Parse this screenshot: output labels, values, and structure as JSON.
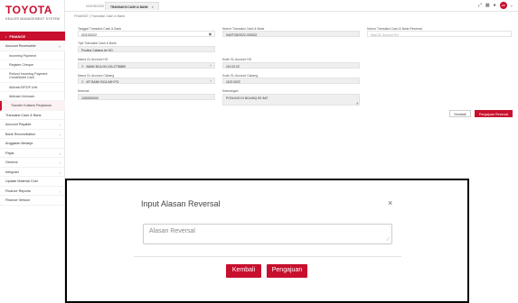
{
  "brand": {
    "name": "TOYOTA",
    "tagline": "DEALER MANAGEMENT SYSTEM",
    "color": "#c8102e"
  },
  "sidebar": {
    "section": "FINANCE",
    "items": [
      {
        "label": "Account Receivable",
        "expanded": true
      },
      {
        "label": "Transaksi Cash & Bank"
      },
      {
        "label": "Account Payable"
      },
      {
        "label": "Bank Reconciliation"
      },
      {
        "label": "Anggaran Belanja"
      },
      {
        "label": "Pajak"
      },
      {
        "label": "General"
      },
      {
        "label": "Integrasi"
      },
      {
        "label": "Update Material Cost"
      },
      {
        "label": "Finance Reports"
      },
      {
        "label": "Finance Version"
      }
    ],
    "submenu": [
      {
        "label": "Incoming Payment"
      },
      {
        "label": "Register Cheque"
      },
      {
        "label": "Refund Incoming Payment Credit/Debit Card"
      },
      {
        "label": "Aktivasi BF/DP Unit"
      },
      {
        "label": "Aktivasi Unknown"
      },
      {
        "label": "Transfer Kuitansi Perjalanan"
      }
    ]
  },
  "topbar": {
    "tabs": [
      {
        "label": "DASHBOARD"
      },
      {
        "label": "TRANSAKSI CASH & BANK",
        "active": true
      }
    ],
    "avatar_initials": "AB"
  },
  "breadcrumb": "FINANCE  |  Transaksi Cash & Bank",
  "form": {
    "tanggal_label": "Tanggal Transaksi Cash & Bank",
    "tanggal_value": "02/12/2022",
    "nomor_label": "Nomor Transaksi Cash & Bank",
    "nomor_value": "040/TCB/2022-000022",
    "nomor_reversal_label": "Nomor Transaksi Cash & Bank Reversal",
    "nomor_reversal_placeholder": "Nilai GL Account HO",
    "tipe_label": "Tipe Transaksi Cash & Bank",
    "tipe_value": "Pooling Cabang ke HO",
    "gl_ho_label": "Nama GL Account HO",
    "gl_ho_value": "BANK BCA (IN 100-2778889",
    "kode_ho_label": "Kode GL Account HO",
    "kode_ho_value": "110.02.02",
    "gl_cabang_label": "Nama GL Account Cabang",
    "gl_cabang_value": "MT BANK BCA (MH PO",
    "kode_cabang_label": "Kode GL Account Cabang",
    "kode_cabang_value": "1102.0022",
    "nominal_label": "Nominal",
    "nominal_value": "1000000000",
    "keterangan_label": "Keterangan",
    "keterangan_value": "POOLING DI BCA/MQ KE 8AT",
    "btn_kembali": "Kembali",
    "btn_pengajuan": "Pengajuan Reversal"
  },
  "modal": {
    "title": "Input Alasan Reversal",
    "input_placeholder": "Alasan Reversal",
    "btn_kembali": "Kembali",
    "btn_pengajuan": "Pengajuan"
  }
}
